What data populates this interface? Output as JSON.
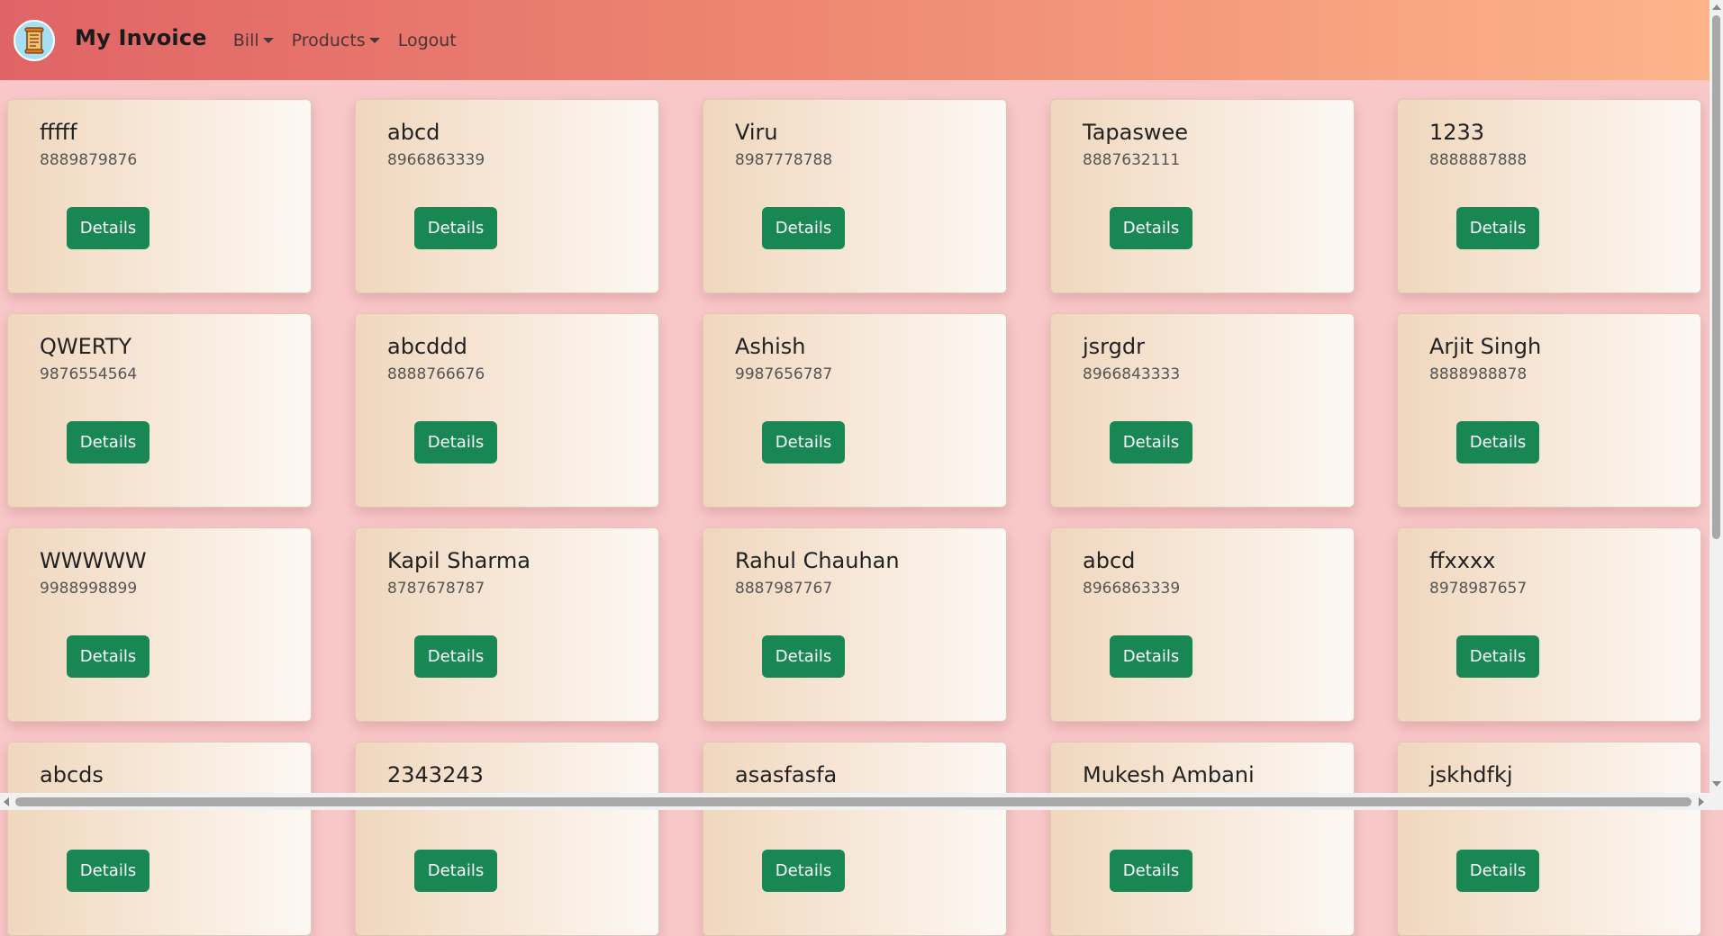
{
  "navbar": {
    "brand": "My Invoice",
    "logo_icon": "invoice-scroll-icon",
    "menu": {
      "bill": "Bill",
      "products": "Products",
      "logout": "Logout"
    },
    "colors": {
      "gradient_start": "#e06466",
      "gradient_end": "#fdb489"
    }
  },
  "customers": [
    {
      "name": "fffff",
      "phone": "8889879876",
      "button": "Details"
    },
    {
      "name": "abcd",
      "phone": "8966863339",
      "button": "Details"
    },
    {
      "name": "Viru",
      "phone": "8987778788",
      "button": "Details"
    },
    {
      "name": "Tapaswee",
      "phone": "8887632111",
      "button": "Details"
    },
    {
      "name": "1233",
      "phone": "8888887888",
      "button": "Details"
    },
    {
      "name": "QWERTY",
      "phone": "9876554564",
      "button": "Details"
    },
    {
      "name": "abcddd",
      "phone": "8888766676",
      "button": "Details"
    },
    {
      "name": "Ashish",
      "phone": "9987656787",
      "button": "Details"
    },
    {
      "name": "jsrgdr",
      "phone": "8966843333",
      "button": "Details"
    },
    {
      "name": "Arjit Singh",
      "phone": "8888988878",
      "button": "Details"
    },
    {
      "name": "WWWWW",
      "phone": "9988998899",
      "button": "Details"
    },
    {
      "name": "Kapil Sharma",
      "phone": "8787678787",
      "button": "Details"
    },
    {
      "name": "Rahul Chauhan",
      "phone": "8887987767",
      "button": "Details"
    },
    {
      "name": "abcd",
      "phone": "8966863339",
      "button": "Details"
    },
    {
      "name": "ffxxxx",
      "phone": "8978987657",
      "button": "Details"
    },
    {
      "name": "abcds",
      "phone": "",
      "button": "Details"
    },
    {
      "name": "2343243",
      "phone": "",
      "button": "Details"
    },
    {
      "name": "asasfasfa",
      "phone": "",
      "button": "Details"
    },
    {
      "name": "Mukesh Ambani",
      "phone": "",
      "button": "Details"
    },
    {
      "name": "jskhdfkj",
      "phone": "",
      "button": "Details"
    }
  ],
  "colors": {
    "page_background": "#f8c8c9",
    "button": "#198754",
    "card_gradient_start": "#f0d7bd",
    "card_gradient_end": "#fdf8f4"
  }
}
